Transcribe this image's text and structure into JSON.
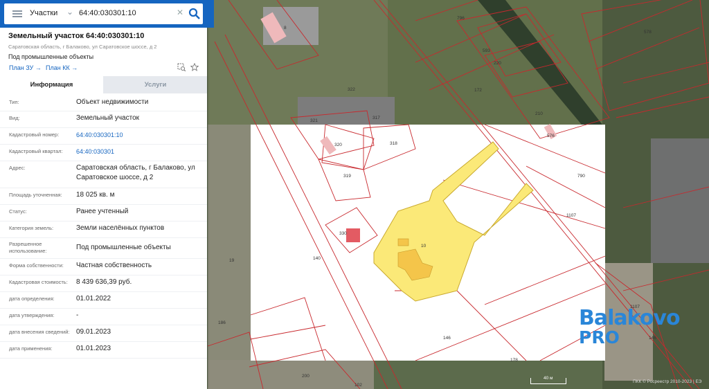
{
  "search": {
    "type_label": "Участки",
    "query": "64:40:030301:10"
  },
  "object": {
    "title": "Земельный участок 64:40:030301:10",
    "address_small": "Саратовская область, г Балаково, ул Саратовское шоссе, д 2",
    "purpose": "Под промышленные объекты",
    "link_zu": "План ЗУ →",
    "link_kk": "План КК →"
  },
  "tabs": {
    "info": "Информация",
    "services": "Услуги"
  },
  "fields": [
    {
      "label": "Тип:",
      "value": "Объект недвижимости"
    },
    {
      "label": "Вид:",
      "value": "Земельный участок"
    },
    {
      "label": "Кадастровый номер:",
      "value": "64:40:030301:10"
    },
    {
      "label": "Кадастровый квартал:",
      "value": "64:40:030301"
    },
    {
      "label": "Адрес:",
      "value": "Саратовская область, г Балаково, ул Саратовское шоссе, д 2"
    },
    {
      "label": "Площадь уточненная:",
      "value": "18 025 кв. м"
    },
    {
      "label": "Статус:",
      "value": "Ранее учтенный"
    },
    {
      "label": "Категория земель:",
      "value": "Земли населённых пунктов"
    },
    {
      "label": "Разрешенное использование:",
      "value": "Под промышленные объекты"
    },
    {
      "label": "Форма собственности:",
      "value": "Частная собственность"
    },
    {
      "label": "Кадастровая стоимость:",
      "value": "8 439 636,39 руб."
    },
    {
      "label": "дата определения:",
      "value": "01.01.2022"
    },
    {
      "label": "дата утверждения:",
      "value": "-"
    },
    {
      "label": "дата внесения сведений:",
      "value": "09.01.2023"
    },
    {
      "label": "дата применения:",
      "value": "01.01.2023"
    }
  ],
  "map": {
    "parcel_labels": [
      "796",
      "593",
      "220",
      "210",
      "576",
      "790",
      "1107",
      "322",
      "321",
      "317",
      "318",
      "320",
      "319",
      "330",
      "10",
      "146",
      "178",
      "200",
      "102",
      "186",
      "19",
      "8",
      "578",
      "1107",
      "146",
      "172",
      "140"
    ],
    "scale_label": "40 м",
    "copyright": "ПКК © Росреестр 2010-2023 | ЕЭ"
  },
  "logo": {
    "line1": "Balakovo",
    "line2": "PRO"
  },
  "colors": {
    "header": "#1565c0",
    "parcel_line": "#c8282d",
    "selected_fill": "#fbe978",
    "logo": "#2a86d8"
  }
}
